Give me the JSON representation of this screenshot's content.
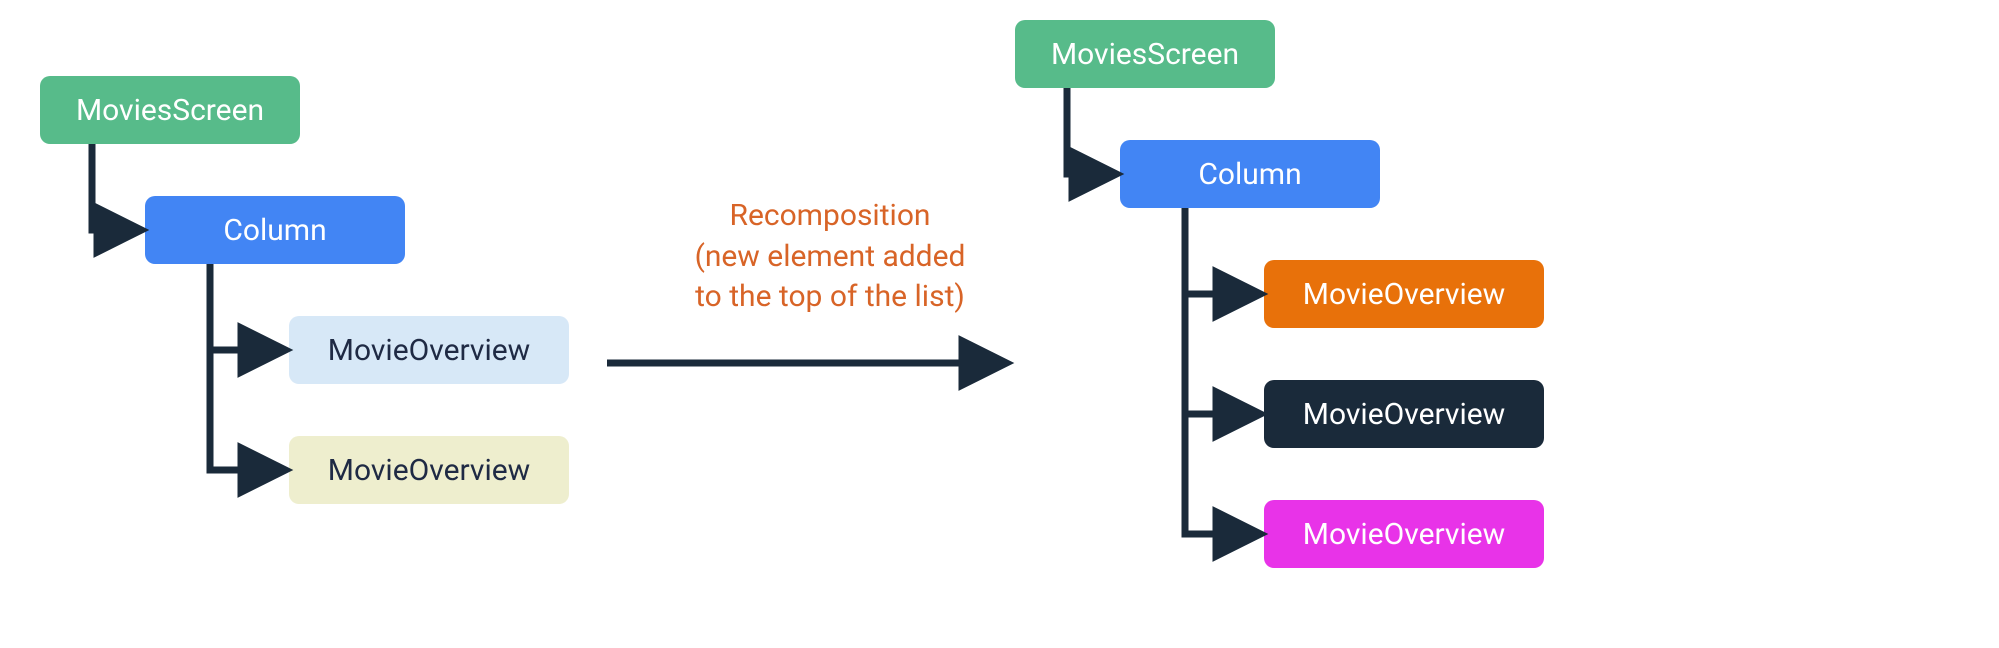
{
  "left_tree": {
    "root": "MoviesScreen",
    "column": "Column",
    "items": [
      "MovieOverview",
      "MovieOverview"
    ]
  },
  "right_tree": {
    "root": "MoviesScreen",
    "column": "Column",
    "items": [
      "MovieOverview",
      "MovieOverview",
      "MovieOverview"
    ]
  },
  "caption": {
    "line1": "Recomposition",
    "line2": "(new element added",
    "line3": "to the top of the list)"
  },
  "colors": {
    "green": "#57bb8a",
    "blue": "#4285f4",
    "lightblue": "#d7e8f7",
    "cream": "#eeeece",
    "orange_node": "#e8710a",
    "navy": "#1a2a3a",
    "magenta": "#e833e8",
    "caption": "#d86427",
    "stroke": "#1a2a3a"
  }
}
